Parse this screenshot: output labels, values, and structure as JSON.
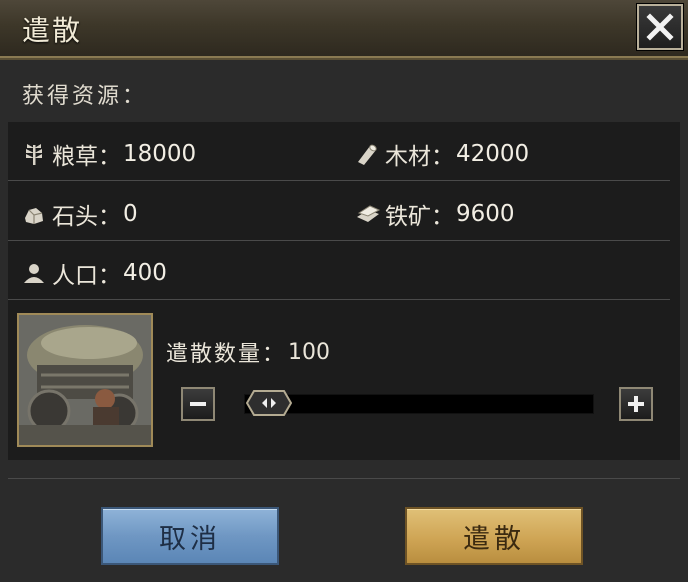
{
  "dialog": {
    "title": "遣散"
  },
  "resources": {
    "heading": "获得资源：",
    "items": [
      {
        "key": "grain",
        "label": "粮草：",
        "value": "18000"
      },
      {
        "key": "wood",
        "label": "木材：",
        "value": "42000"
      },
      {
        "key": "stone",
        "label": "石头：",
        "value": "0"
      },
      {
        "key": "iron",
        "label": "铁矿：",
        "value": "9600"
      },
      {
        "key": "population",
        "label": "人口：",
        "value": "400"
      }
    ]
  },
  "dismiss": {
    "quantity_label": "遣散数量：",
    "quantity_value": "100",
    "slider_fraction": 0.0
  },
  "buttons": {
    "cancel": "取消",
    "confirm": "遣散"
  },
  "colors": {
    "accent_gold": "#cfa555",
    "cancel_blue": "#6f97c3",
    "frame_gold": "#8a7a52"
  }
}
